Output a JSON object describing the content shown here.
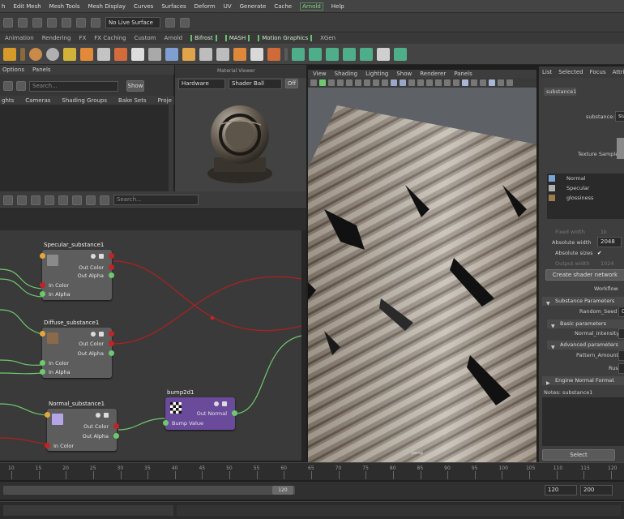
{
  "menubar": {
    "items": [
      "h",
      "Edit Mesh",
      "Mesh Tools",
      "Mesh Display",
      "Curves",
      "Surfaces",
      "Deform",
      "UV",
      "Generate",
      "Cache",
      "Arnold",
      "Help"
    ]
  },
  "statusline": {
    "live_surface": "No Live Surface"
  },
  "shelf_tabs": [
    "Animation",
    "Rendering",
    "FX",
    "FX Caching",
    "Custom",
    "Arnold",
    "Bifrost",
    "MASH",
    "Motion Graphics",
    "XGen"
  ],
  "outliner": {
    "menu": [
      "Options",
      "Panels"
    ],
    "search_placeholder": "Search...",
    "show_button": "Show",
    "tabs": [
      "ghts",
      "Cameras",
      "Shading Groups",
      "Bake Sets",
      "Proje"
    ]
  },
  "material_viewer": {
    "title": "Material Viewer",
    "renderer": "Hardware",
    "shape": "Shader Ball",
    "toggle": "Off"
  },
  "node_editor": {
    "search_placeholder": "Search...",
    "nodes": [
      {
        "name": "Specular_substance1",
        "outputs": [
          "Out Color",
          "Out Alpha"
        ],
        "inputs": [
          "In Color",
          "In Alpha"
        ]
      },
      {
        "name": "Diffuse_substance1",
        "outputs": [
          "Out Color",
          "Out Alpha"
        ],
        "inputs": [
          "In Color",
          "In Alpha"
        ]
      },
      {
        "name": "Normal_substance1",
        "outputs": [
          "Out Color",
          "Out Alpha"
        ],
        "inputs": [
          "In Color"
        ]
      },
      {
        "name": "bump2d1",
        "outputs": [
          "Out Normal"
        ],
        "inputs": [
          "Bump Value"
        ]
      }
    ]
  },
  "viewport": {
    "menu": [
      "View",
      "Shading",
      "Lighting",
      "Show",
      "Renderer",
      "Panels"
    ],
    "label": "persp"
  },
  "attribute_editor": {
    "top_menu": [
      "List",
      "Selected",
      "Focus",
      "Attrib"
    ],
    "node_tab": "substance1",
    "substance_label": "substance:",
    "substance_value": "su",
    "texture_sample_label": "Texture Sample",
    "outputs": [
      {
        "label": "Normal",
        "color": "#7aa3d6"
      },
      {
        "label": "Specular",
        "color": "#b0b0b0"
      },
      {
        "label": "glossiness",
        "color": "#9c7b4f"
      }
    ],
    "fields": [
      {
        "label": "Fixed width",
        "value": "1k"
      },
      {
        "label": "Absolute width",
        "value": "2048"
      },
      {
        "label": "Absolute sizes",
        "value": "✔"
      },
      {
        "label": "Output width",
        "value": "1024"
      }
    ],
    "create_button": "Create shader network",
    "workflow_label": "Workflow",
    "sections": [
      {
        "label": "Substance Parameters",
        "rows": [
          {
            "label": "Random_Seed",
            "value": "0"
          }
        ]
      },
      {
        "label": "Basic parameters",
        "rows": [
          {
            "label": "Normal_Intensity",
            "value": ""
          }
        ]
      },
      {
        "label": "Advanced parameters",
        "rows": [
          {
            "label": "Pattern_Amount",
            "value": ""
          },
          {
            "label": "Rust",
            "value": ""
          }
        ]
      },
      {
        "label": "Engine Normal Format",
        "rows": []
      }
    ],
    "notes_label": "Notes: substance1",
    "select_button": "Select"
  },
  "timeline": {
    "ticks": [
      "10",
      "15",
      "20",
      "25",
      "30",
      "35",
      "40",
      "45",
      "50",
      "55",
      "60",
      "65",
      "70",
      "75",
      "80",
      "85",
      "90",
      "95",
      "100",
      "105",
      "110",
      "115",
      "120"
    ]
  },
  "range": {
    "current_end": "120",
    "field_1": "120",
    "field_2": "200"
  },
  "colors": {
    "accent_green": "#6bbf6b",
    "connection_red": "#b02020",
    "connection_green": "#6ec96e",
    "node_purple": "#6a4a9a"
  }
}
